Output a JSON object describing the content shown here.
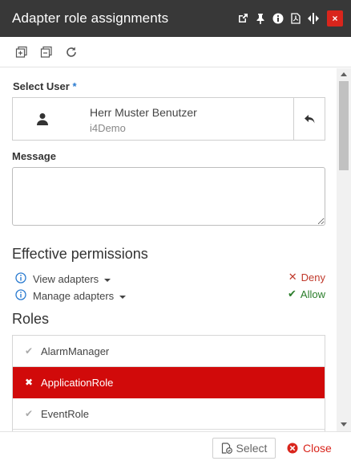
{
  "window": {
    "title": "Adapter role assignments",
    "icons": [
      "external-link-icon",
      "pin-icon",
      "info-icon",
      "pdf-icon",
      "resize-horizontal-icon",
      "close-icon"
    ],
    "close_symbol": "×"
  },
  "toolbar": {
    "icons": [
      "expand-all-icon",
      "collapse-all-icon",
      "refresh-icon"
    ]
  },
  "select_user": {
    "label": "Select User",
    "required_mark": "*",
    "name": "Herr Muster Benutzer",
    "org": "i4Demo"
  },
  "message": {
    "label": "Message",
    "value": ""
  },
  "effective_permissions": {
    "heading": "Effective permissions",
    "items": [
      {
        "label": "View adapters"
      },
      {
        "label": "Manage adapters"
      }
    ],
    "legend": {
      "deny_symbol": "✕",
      "deny": "Deny",
      "allow_symbol": "✔",
      "allow": "Allow"
    }
  },
  "roles": {
    "heading": "Roles",
    "items": [
      {
        "name": "AlarmManager",
        "symbol": "✔",
        "selected": false
      },
      {
        "name": "ApplicationRole",
        "symbol": "✖",
        "selected": true
      },
      {
        "name": "EventRole",
        "symbol": "✔",
        "selected": false
      }
    ]
  },
  "footer": {
    "select_label": "Select",
    "close_label": "Close"
  },
  "colors": {
    "titlebar": "#383838",
    "accent_red": "#d10a0a",
    "allow_green": "#2a7d2a",
    "info_blue": "#2a7bd0"
  }
}
